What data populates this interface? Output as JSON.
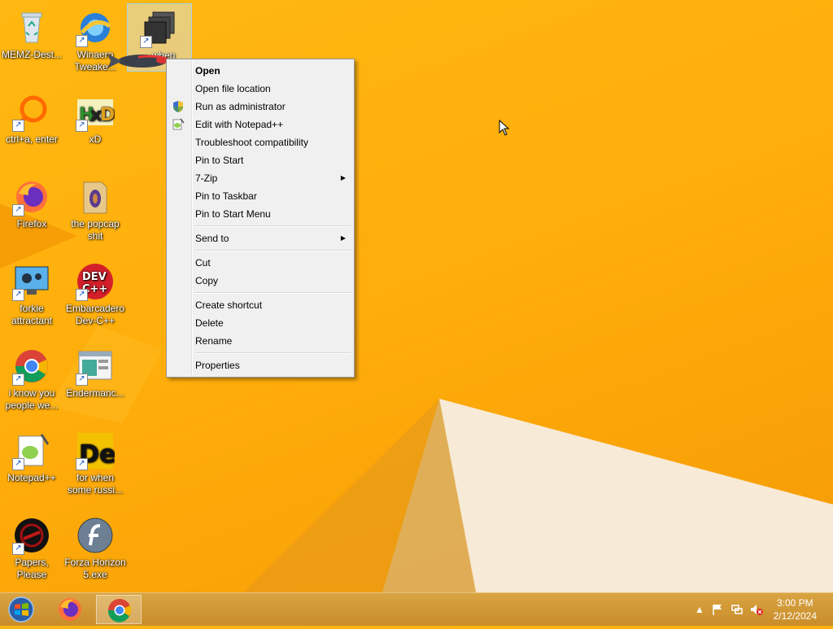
{
  "desktop": {
    "icons": [
      {
        "label": "MEMZ-Dest...",
        "icon": "recycle-bin-icon"
      },
      {
        "label": "Winaero Tweake...",
        "icon": "winaero-icon"
      },
      {
        "label": "",
        "icon": "window-stack-icon"
      },
      {
        "label": "ctrl+a, enter",
        "icon": "ring-icon"
      },
      {
        "label": "xD",
        "icon": "hxd-icon"
      },
      {
        "label": "Firefox",
        "icon": "firefox-icon"
      },
      {
        "label": "the popcap shit",
        "icon": "folder-icon"
      },
      {
        "label": "forkie attractant",
        "icon": "monitor-gear-icon"
      },
      {
        "label": "Embarcadero Dev-C++",
        "icon": "devcpp-icon"
      },
      {
        "label": "i know you people we...",
        "icon": "chrome-icon"
      },
      {
        "label": "Endermanc...",
        "icon": "app-window-icon"
      },
      {
        "label": "Notepad++",
        "icon": "notepadpp-icon"
      },
      {
        "label": "for when some russi...",
        "icon": "de-icon"
      },
      {
        "label": "Papers, Please",
        "icon": "papers-please-icon"
      },
      {
        "label": "Forza Horizon 5.exe",
        "icon": "flash-icon"
      }
    ],
    "selected_partial_label": "...when"
  },
  "context_menu": {
    "items": [
      {
        "label": "Open",
        "bold": true
      },
      {
        "label": "Open file location"
      },
      {
        "label": "Run as administrator",
        "icon": "uac-shield-icon"
      },
      {
        "label": "Edit with Notepad++",
        "icon": "notepadpp-icon"
      },
      {
        "label": "Troubleshoot compatibility"
      },
      {
        "label": "Pin to Start"
      },
      {
        "label": "7-Zip",
        "submenu": true
      },
      {
        "label": "Pin to Taskbar"
      },
      {
        "label": "Pin to Start Menu"
      },
      {
        "label": "Send to",
        "submenu": true
      },
      {
        "label": "Cut"
      },
      {
        "label": "Copy"
      },
      {
        "label": "Create shortcut"
      },
      {
        "label": "Delete"
      },
      {
        "label": "Rename"
      },
      {
        "label": "Properties"
      }
    ]
  },
  "taskbar": {
    "start_icon": "windows-start-orb-icon",
    "pinned": [
      {
        "name": "firefox",
        "icon": "firefox-icon"
      },
      {
        "name": "chrome",
        "icon": "chrome-icon",
        "active": true
      }
    ],
    "tray": {
      "time": "3:00 PM",
      "date": "2/12/2024",
      "icons": [
        "show-hidden-icon",
        "action-center-flag-icon",
        "network-icon",
        "volume-muted-icon"
      ]
    }
  },
  "colors": {
    "wallpaper": "#ffb00f",
    "menu_bg": "#f0f0f0",
    "taskbar": "#d19a36"
  }
}
